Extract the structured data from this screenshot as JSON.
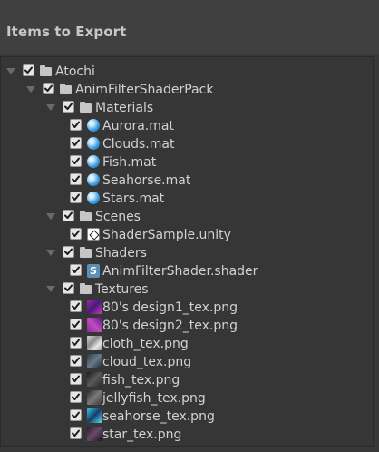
{
  "header": {
    "title": "Items to Export"
  },
  "colors": {
    "background": "#383838",
    "header": "#404040",
    "text": "#d2d2d2",
    "checkbox": "#e6e6e6",
    "material_blue": "#3a9bdc"
  },
  "tree": {
    "items": [
      {
        "label": "Atochi",
        "icon": "folder-icon",
        "depth": 0,
        "foldout": true,
        "checked": true
      },
      {
        "label": "AnimFilterShaderPack",
        "icon": "folder-icon",
        "depth": 1,
        "foldout": true,
        "checked": true
      },
      {
        "label": "Materials",
        "icon": "folder-icon",
        "depth": 2,
        "foldout": true,
        "checked": true
      },
      {
        "label": "Aurora.mat",
        "icon": "material-icon",
        "depth": 3,
        "foldout": false,
        "checked": true
      },
      {
        "label": "Clouds.mat",
        "icon": "material-icon",
        "depth": 3,
        "foldout": false,
        "checked": true
      },
      {
        "label": "Fish.mat",
        "icon": "material-icon",
        "depth": 3,
        "foldout": false,
        "checked": true
      },
      {
        "label": "Seahorse.mat",
        "icon": "material-icon",
        "depth": 3,
        "foldout": false,
        "checked": true
      },
      {
        "label": "Stars.mat",
        "icon": "material-icon",
        "depth": 3,
        "foldout": false,
        "checked": true
      },
      {
        "label": "Scenes",
        "icon": "folder-icon",
        "depth": 2,
        "foldout": true,
        "checked": true
      },
      {
        "label": "ShaderSample.unity",
        "icon": "unity-scene-icon",
        "depth": 3,
        "foldout": false,
        "checked": true
      },
      {
        "label": "Shaders",
        "icon": "folder-icon",
        "depth": 2,
        "foldout": true,
        "checked": true
      },
      {
        "label": "AnimFilterShader.shader",
        "icon": "shader-icon",
        "depth": 3,
        "foldout": false,
        "checked": true
      },
      {
        "label": "Textures",
        "icon": "folder-icon",
        "depth": 2,
        "foldout": true,
        "checked": true
      },
      {
        "label": "80's design1_tex.png",
        "icon": "texture-icon",
        "depth": 3,
        "foldout": false,
        "checked": true
      },
      {
        "label": "80's design2_tex.png",
        "icon": "texture-icon",
        "depth": 3,
        "foldout": false,
        "checked": true
      },
      {
        "label": "cloth_tex.png",
        "icon": "texture-icon",
        "depth": 3,
        "foldout": false,
        "checked": true
      },
      {
        "label": "cloud_tex.png",
        "icon": "texture-icon",
        "depth": 3,
        "foldout": false,
        "checked": true
      },
      {
        "label": "fish_tex.png",
        "icon": "texture-icon",
        "depth": 3,
        "foldout": false,
        "checked": true
      },
      {
        "label": "jellyfish_tex.png",
        "icon": "texture-icon",
        "depth": 3,
        "foldout": false,
        "checked": true
      },
      {
        "label": "seahorse_tex.png",
        "icon": "texture-icon",
        "depth": 3,
        "foldout": false,
        "checked": true
      },
      {
        "label": "star_tex.png",
        "icon": "texture-icon",
        "depth": 3,
        "foldout": false,
        "checked": true
      }
    ]
  }
}
